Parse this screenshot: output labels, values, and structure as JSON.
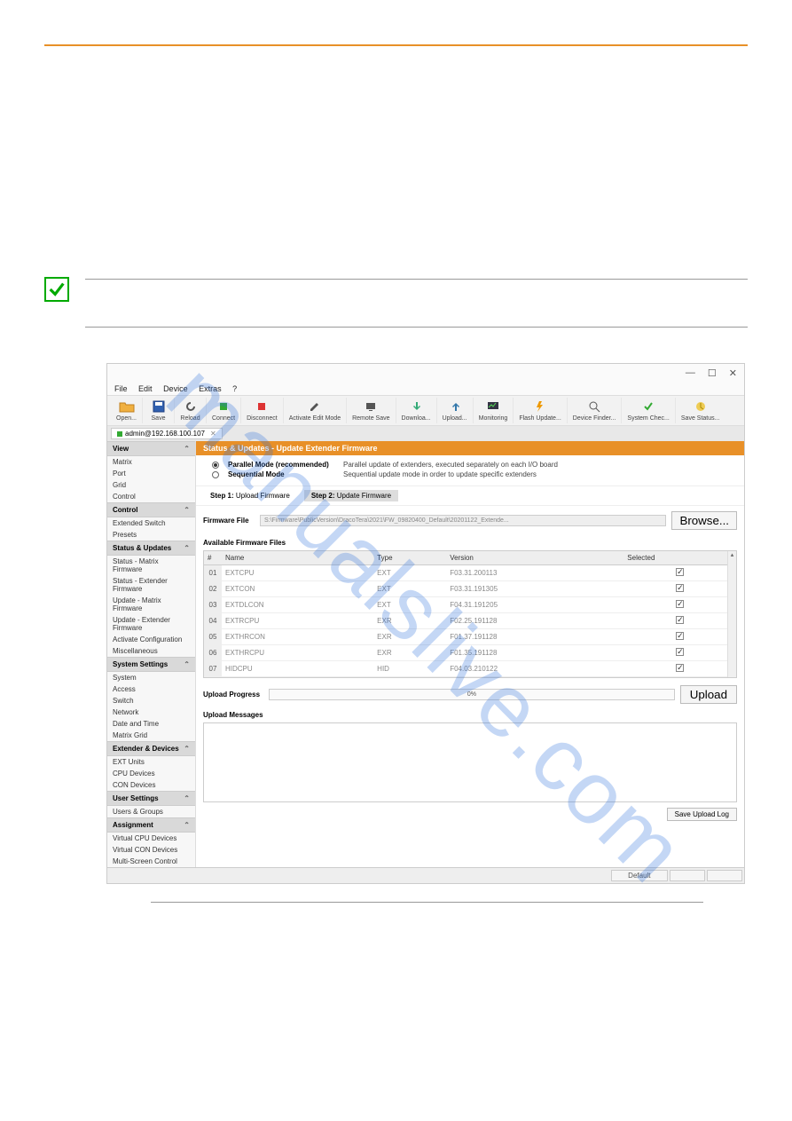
{
  "watermark": "manualslive.com",
  "titlebar": {
    "min": "—",
    "max": "☐",
    "close": "✕"
  },
  "menubar": [
    "File",
    "Edit",
    "Device",
    "Extras",
    "?"
  ],
  "toolbar": [
    {
      "icon": "open",
      "label": "Open..."
    },
    {
      "icon": "save",
      "label": "Save"
    },
    {
      "icon": "reload",
      "label": "Reload"
    },
    {
      "icon": "connect",
      "label": "Connect"
    },
    {
      "icon": "disconnect",
      "label": "Disconnect"
    },
    {
      "icon": "edit",
      "label": "Activate Edit Mode"
    },
    {
      "icon": "remote",
      "label": "Remote Save"
    },
    {
      "icon": "download",
      "label": "Downloa..."
    },
    {
      "icon": "upload",
      "label": "Upload..."
    },
    {
      "icon": "monitor",
      "label": "Monitoring"
    },
    {
      "icon": "flash",
      "label": "Flash Update..."
    },
    {
      "icon": "finder",
      "label": "Device Finder..."
    },
    {
      "icon": "check",
      "label": "System Chec..."
    },
    {
      "icon": "status",
      "label": "Save Status..."
    }
  ],
  "conn_tab": "admin@192.168.100.107",
  "sidebar": {
    "sections": [
      {
        "title": "View",
        "items": [
          "Matrix",
          "Port",
          "Grid",
          "Control"
        ]
      },
      {
        "title": "Control",
        "items": [
          "Extended Switch",
          "Presets"
        ]
      },
      {
        "title": "Status & Updates",
        "items": [
          "Status - Matrix Firmware",
          "Status - Extender Firmware",
          "Update - Matrix Firmware",
          "Update - Extender Firmware",
          "Activate Configuration",
          "Miscellaneous"
        ]
      },
      {
        "title": "System Settings",
        "items": [
          "System",
          "Access",
          "Switch",
          "Network",
          "Date and Time",
          "Matrix Grid"
        ]
      },
      {
        "title": "Extender & Devices",
        "items": [
          "EXT Units",
          "CPU Devices",
          "CON Devices"
        ]
      },
      {
        "title": "User Settings",
        "items": [
          "Users & Groups"
        ]
      },
      {
        "title": "Assignment",
        "items": [
          "Virtual CPU Devices",
          "Virtual CON Devices",
          "Multi-Screen Control"
        ]
      }
    ]
  },
  "main": {
    "header": "Status & Updates - Update Extender Firmware",
    "modes": [
      {
        "label": "Parallel Mode (recommended)",
        "desc": "Parallel update of extenders, executed separately on each I/O board",
        "checked": true
      },
      {
        "label": "Sequential Mode",
        "desc": "Sequential update mode in order to update specific extenders",
        "checked": false
      }
    ],
    "step1_label": "Step 1:",
    "step1_text": "Upload Firmware",
    "step2_label": "Step 2:",
    "step2_text": "Update Firmware",
    "fw_file_label": "Firmware File",
    "fw_path": "S:\\Firmware\\PublicVersion\\DracoTera\\2021\\FW_09820400_Default\\20201122_Extende...",
    "browse": "Browse...",
    "avail_label": "Available Firmware Files",
    "columns": [
      "#",
      "Name",
      "Type",
      "Version",
      "Selected"
    ],
    "rows": [
      {
        "n": "01",
        "name": "EXTCPU",
        "type": "EXT",
        "ver": "F03.31.200113"
      },
      {
        "n": "02",
        "name": "EXTCON",
        "type": "EXT",
        "ver": "F03.31.191305"
      },
      {
        "n": "03",
        "name": "EXTDLCON",
        "type": "EXT",
        "ver": "F04.31.191205"
      },
      {
        "n": "04",
        "name": "EXTRCPU",
        "type": "EXR",
        "ver": "F02.25.191128"
      },
      {
        "n": "05",
        "name": "EXTHRCON",
        "type": "EXR",
        "ver": "F01.37.191128"
      },
      {
        "n": "06",
        "name": "EXTHRCPU",
        "type": "EXR",
        "ver": "F01.35.191128"
      },
      {
        "n": "07",
        "name": "HIDCPU",
        "type": "HID",
        "ver": "F04.03.210122"
      }
    ],
    "progress_label": "Upload Progress",
    "progress_pct": "0%",
    "upload_btn": "Upload",
    "msg_label": "Upload Messages",
    "save_log": "Save Upload Log",
    "status_default": "Default"
  }
}
